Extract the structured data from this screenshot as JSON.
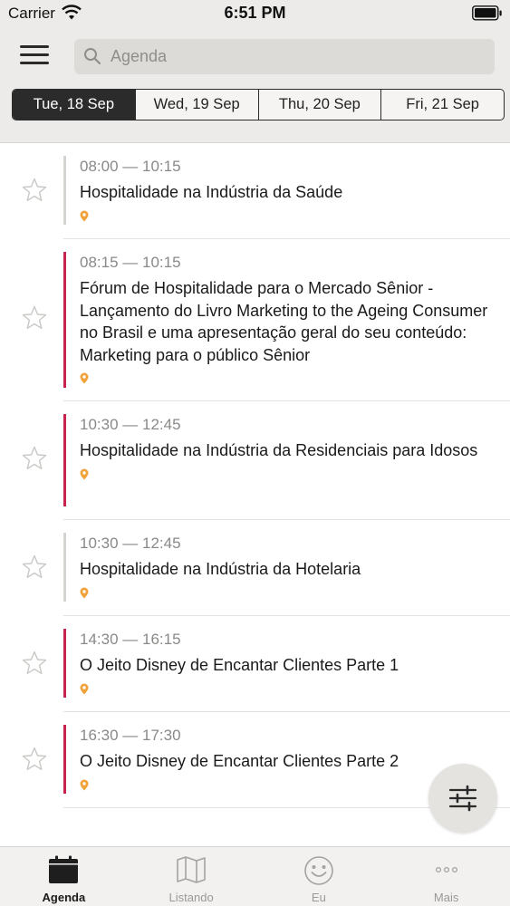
{
  "status_bar": {
    "carrier": "Carrier",
    "time": "6:51 PM"
  },
  "search": {
    "placeholder": "Agenda"
  },
  "date_tabs": [
    {
      "label": "Tue, 18 Sep",
      "active": true
    },
    {
      "label": "Wed, 19 Sep",
      "active": false
    },
    {
      "label": "Thu, 20 Sep",
      "active": false
    },
    {
      "label": "Fri, 21 Sep",
      "active": false
    }
  ],
  "sessions": [
    {
      "time": "08:00 — 10:15",
      "title": "Hospitalidade na Indústria da Saúde",
      "bar_color": "#d5d4d1"
    },
    {
      "time": "08:15 — 10:15",
      "title": "Fórum de Hospitalidade para o Mercado Sênior - Lançamento do Livro Marketing to the Ageing Consumer no Brasil e uma apresentação geral do seu conteúdo: Marketing para o público Sênior",
      "bar_color": "#c8234f"
    },
    {
      "time": "10:30 — 12:45",
      "title": "Hospitalidade na Indústria da Residenciais para Idosos",
      "bar_color": "#c8234f"
    },
    {
      "time": "10:30 — 12:45",
      "title": "Hospitalidade na Indústria da Hotelaria",
      "bar_color": "#d5d4d1"
    },
    {
      "time": "14:30 — 16:15",
      "title": "O Jeito Disney de Encantar Clientes Parte 1",
      "bar_color": "#c8234f"
    },
    {
      "time": "16:30 — 17:30",
      "title": "O Jeito Disney de Encantar Clientes Parte 2",
      "bar_color": "#c8234f"
    }
  ],
  "colors": {
    "pin": "#f0a33a",
    "accent": "#c8234f",
    "neutral_bar": "#d5d4d1"
  },
  "icons": {
    "menu": "hamburger-icon",
    "search": "search-icon",
    "star": "star-outline-icon",
    "pin": "location-pin-icon",
    "filter": "sliders-icon"
  },
  "tab_bar": {
    "items": [
      {
        "label": "Agenda",
        "icon": "calendar-icon",
        "active": true
      },
      {
        "label": "Listando",
        "icon": "map-icon",
        "active": false
      },
      {
        "label": "Eu",
        "icon": "smiley-icon",
        "active": false
      },
      {
        "label": "Mais",
        "icon": "more-dots-icon",
        "active": false
      }
    ]
  }
}
